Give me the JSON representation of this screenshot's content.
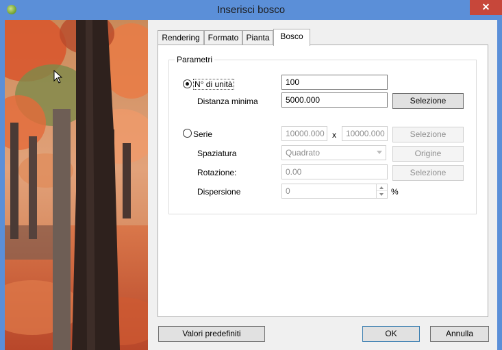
{
  "window": {
    "title": "Inserisci bosco",
    "close_glyph": "✕",
    "app_icon": "tree-leaf-icon"
  },
  "tabs": [
    {
      "label": "Rendering",
      "active": false
    },
    {
      "label": "Formato",
      "active": false
    },
    {
      "label": "Pianta",
      "active": false
    },
    {
      "label": "Bosco",
      "active": true
    }
  ],
  "group": {
    "label": "Parametri"
  },
  "mode_units": {
    "label": "N° di unità",
    "selected": true,
    "count_value": "100",
    "min_distance_label": "Distanza minima",
    "min_distance_value": "5000.000",
    "select_button": "Selezione"
  },
  "mode_series": {
    "label": "Serie",
    "selected": false,
    "x_value": "10000.000",
    "separator": "x",
    "y_value": "10000.000",
    "select_button": "Selezione",
    "spacing_label": "Spaziatura",
    "spacing_value": "Quadrato",
    "origin_button": "Origine",
    "rotation_label": "Rotazione:",
    "rotation_value": "0.00",
    "rotation_button": "Selezione",
    "dispersion_label": "Dispersione",
    "dispersion_value": "0",
    "dispersion_unit": "%"
  },
  "footer": {
    "defaults_button": "Valori predefiniti",
    "ok_button": "OK",
    "cancel_button": "Annulla"
  },
  "colors": {
    "titlebar": "#5b8fd8",
    "close": "#c7473a",
    "panel": "#ffffff",
    "dialog_bg": "#f0f0f0"
  }
}
